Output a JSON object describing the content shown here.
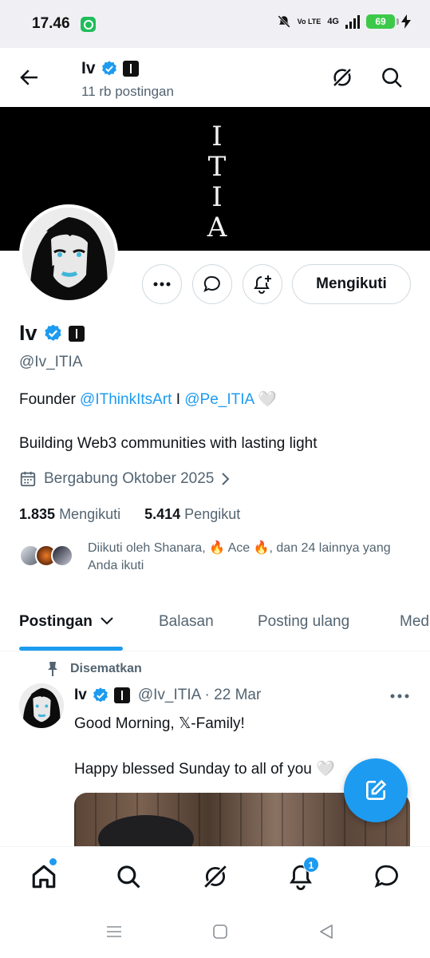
{
  "status_bar": {
    "time": "17.46",
    "volte": "Vo LTE",
    "network": "4G",
    "battery": "69"
  },
  "header": {
    "name": "Iv",
    "post_count": "11 rb postingan"
  },
  "banner": {
    "letters": [
      "I",
      "T",
      "I",
      "A"
    ]
  },
  "actions": {
    "follow_label": "Mengikuti"
  },
  "profile": {
    "name": "Iv",
    "handle": "@Iv_ITIA",
    "bio_prefix": "Founder ",
    "bio_link1": "@IThinkItsArt",
    "bio_sep": " I ",
    "bio_link2": "@Pe_ITIA",
    "bio_heart": " 🤍",
    "bio_line2": "Building Web3 communities with lasting light",
    "joined": "Bergabung Oktober 2025",
    "following_count": "1.835",
    "following_label": "Mengikuti",
    "followers_count": "5.414",
    "followers_label": "Pengikut",
    "followed_by": "Diikuti oleh Shanara, 🔥 Ace 🔥, dan 24 lainnya yang Anda ikuti"
  },
  "tabs": [
    {
      "label": "Postingan"
    },
    {
      "label": "Balasan"
    },
    {
      "label": "Posting ulang"
    },
    {
      "label": "Media"
    }
  ],
  "tweet": {
    "pinned_label": "Disematkan",
    "name": "Iv",
    "handle_date": "@Iv_ITIA · 22 Mar",
    "line1": "Good Morning, 𝕏-Family!",
    "line2": "Happy blessed Sunday to all of you 🤍"
  },
  "bottom_nav": {
    "items": [
      "home-icon",
      "search-icon",
      "grok-icon",
      "notifications-icon",
      "messages-icon"
    ],
    "notification_count": "1"
  },
  "colors": {
    "accent": "#1d9bf0",
    "text": "#0f1419",
    "muted": "#536471"
  }
}
